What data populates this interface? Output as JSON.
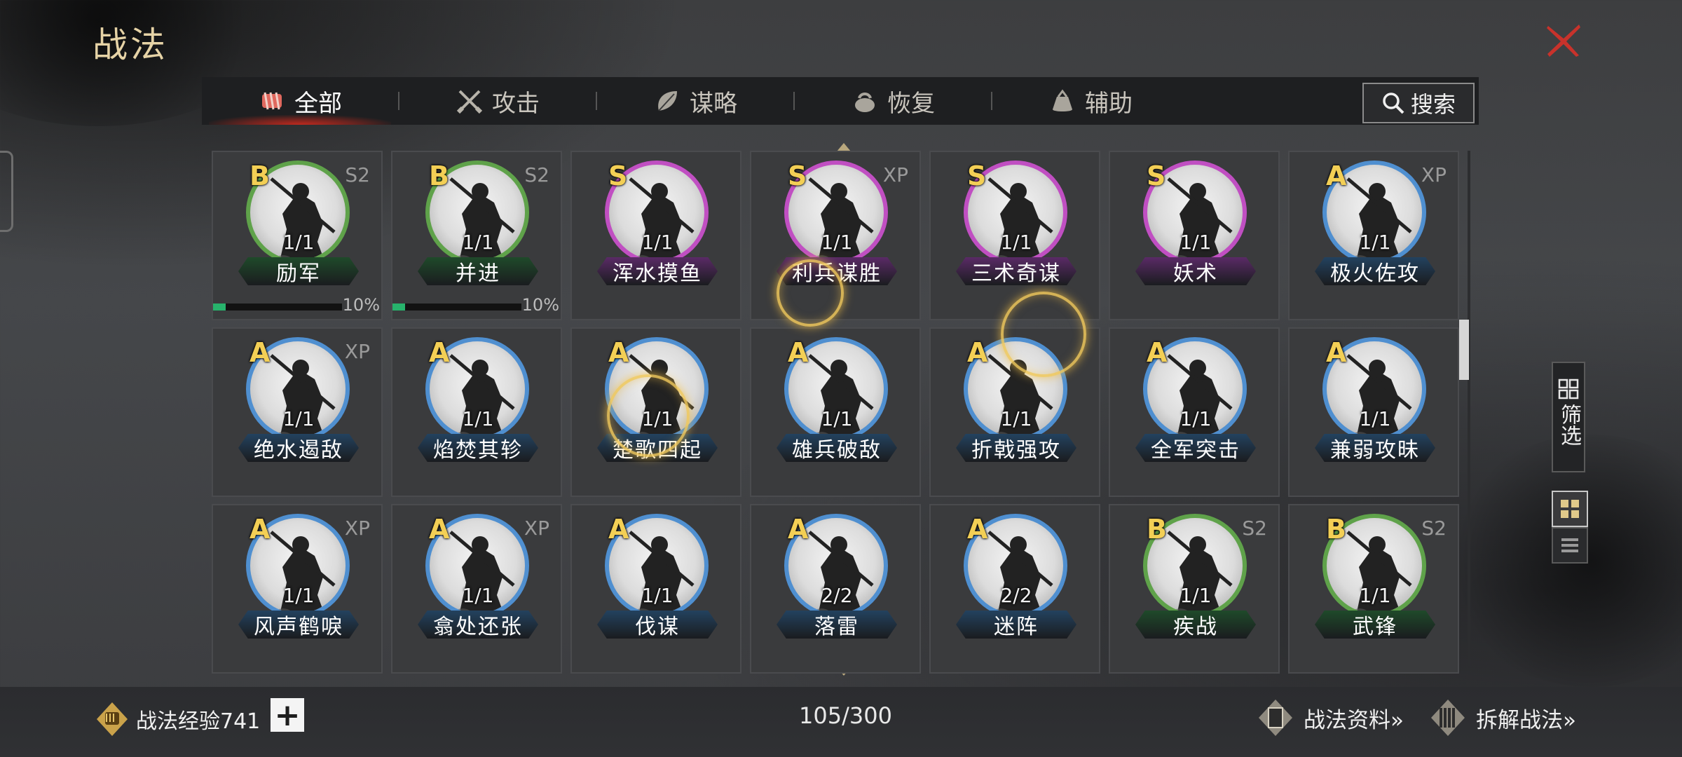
{
  "header": {
    "title": "战法",
    "close_icon": "close-x-icon"
  },
  "tabs": [
    {
      "label": "全部",
      "icon": "all-scroll-icon",
      "active": true
    },
    {
      "label": "攻击",
      "icon": "crossed-swords-icon",
      "active": false
    },
    {
      "label": "谋略",
      "icon": "feather-fan-icon",
      "active": false
    },
    {
      "label": "恢复",
      "icon": "herb-pot-icon",
      "active": false
    },
    {
      "label": "辅助",
      "icon": "pouch-icon",
      "active": false
    }
  ],
  "search": {
    "label": "搜索",
    "icon": "search-icon"
  },
  "skills": [
    {
      "rank": "B",
      "tag": "S2",
      "level": "1/1",
      "name": "励军",
      "ring": "green",
      "progress": 10,
      "progress_label": "10%"
    },
    {
      "rank": "B",
      "tag": "S2",
      "level": "1/1",
      "name": "并进",
      "ring": "green",
      "progress": 10,
      "progress_label": "10%"
    },
    {
      "rank": "S",
      "tag": "",
      "level": "1/1",
      "name": "浑水摸鱼",
      "ring": "purple"
    },
    {
      "rank": "S",
      "tag": "XP",
      "level": "1/1",
      "name": "利兵谋胜",
      "ring": "purple"
    },
    {
      "rank": "S",
      "tag": "",
      "level": "1/1",
      "name": "三术奇谋",
      "ring": "purple"
    },
    {
      "rank": "S",
      "tag": "",
      "level": "1/1",
      "name": "妖术",
      "ring": "purple"
    },
    {
      "rank": "A",
      "tag": "XP",
      "level": "1/1",
      "name": "极火佐攻",
      "ring": "blue"
    },
    {
      "rank": "A",
      "tag": "XP",
      "level": "1/1",
      "name": "绝水遏敌",
      "ring": "blue"
    },
    {
      "rank": "A",
      "tag": "",
      "level": "1/1",
      "name": "焰焚其轸",
      "ring": "blue"
    },
    {
      "rank": "A",
      "tag": "",
      "level": "1/1",
      "name": "楚歌四起",
      "ring": "blue"
    },
    {
      "rank": "A",
      "tag": "",
      "level": "1/1",
      "name": "雄兵破敌",
      "ring": "blue"
    },
    {
      "rank": "A",
      "tag": "",
      "level": "1/1",
      "name": "折戟强攻",
      "ring": "blue"
    },
    {
      "rank": "A",
      "tag": "",
      "level": "1/1",
      "name": "全军突击",
      "ring": "blue"
    },
    {
      "rank": "A",
      "tag": "",
      "level": "1/1",
      "name": "兼弱攻昧",
      "ring": "blue"
    },
    {
      "rank": "A",
      "tag": "XP",
      "level": "1/1",
      "name": "风声鹤唳",
      "ring": "blue"
    },
    {
      "rank": "A",
      "tag": "XP",
      "level": "1/1",
      "name": "翕处还张",
      "ring": "blue"
    },
    {
      "rank": "A",
      "tag": "",
      "level": "1/1",
      "name": "伐谋",
      "ring": "blue"
    },
    {
      "rank": "A",
      "tag": "",
      "level": "2/2",
      "name": "落雷",
      "ring": "blue"
    },
    {
      "rank": "A",
      "tag": "",
      "level": "2/2",
      "name": "迷阵",
      "ring": "blue"
    },
    {
      "rank": "B",
      "tag": "S2",
      "level": "1/1",
      "name": "疾战",
      "ring": "green"
    },
    {
      "rank": "B",
      "tag": "S2",
      "level": "1/1",
      "name": "武锋",
      "ring": "green"
    }
  ],
  "ring_colors": {
    "green": "#5fa24a",
    "purple": "#c04fc2",
    "blue": "#4f8fd0"
  },
  "name_colors": {
    "green": "#1f4a2a",
    "purple": "#5a2a66",
    "blue": "#23425f"
  },
  "side_tools": {
    "filter_label": "筛选",
    "filter_icon": "filter-grid-icon",
    "grid_view_icon": "grid-view-icon",
    "list_view_icon": "list-view-icon"
  },
  "footer": {
    "exp_label": "战法经验741",
    "exp_icon": "fist-badge-icon",
    "add_icon": "plus-icon",
    "count": "105/300",
    "info_label": "战法资料»",
    "info_icon": "book-icon",
    "dismantle_label": "拆解战法»",
    "dismantle_icon": "scroll-bundle-icon"
  }
}
